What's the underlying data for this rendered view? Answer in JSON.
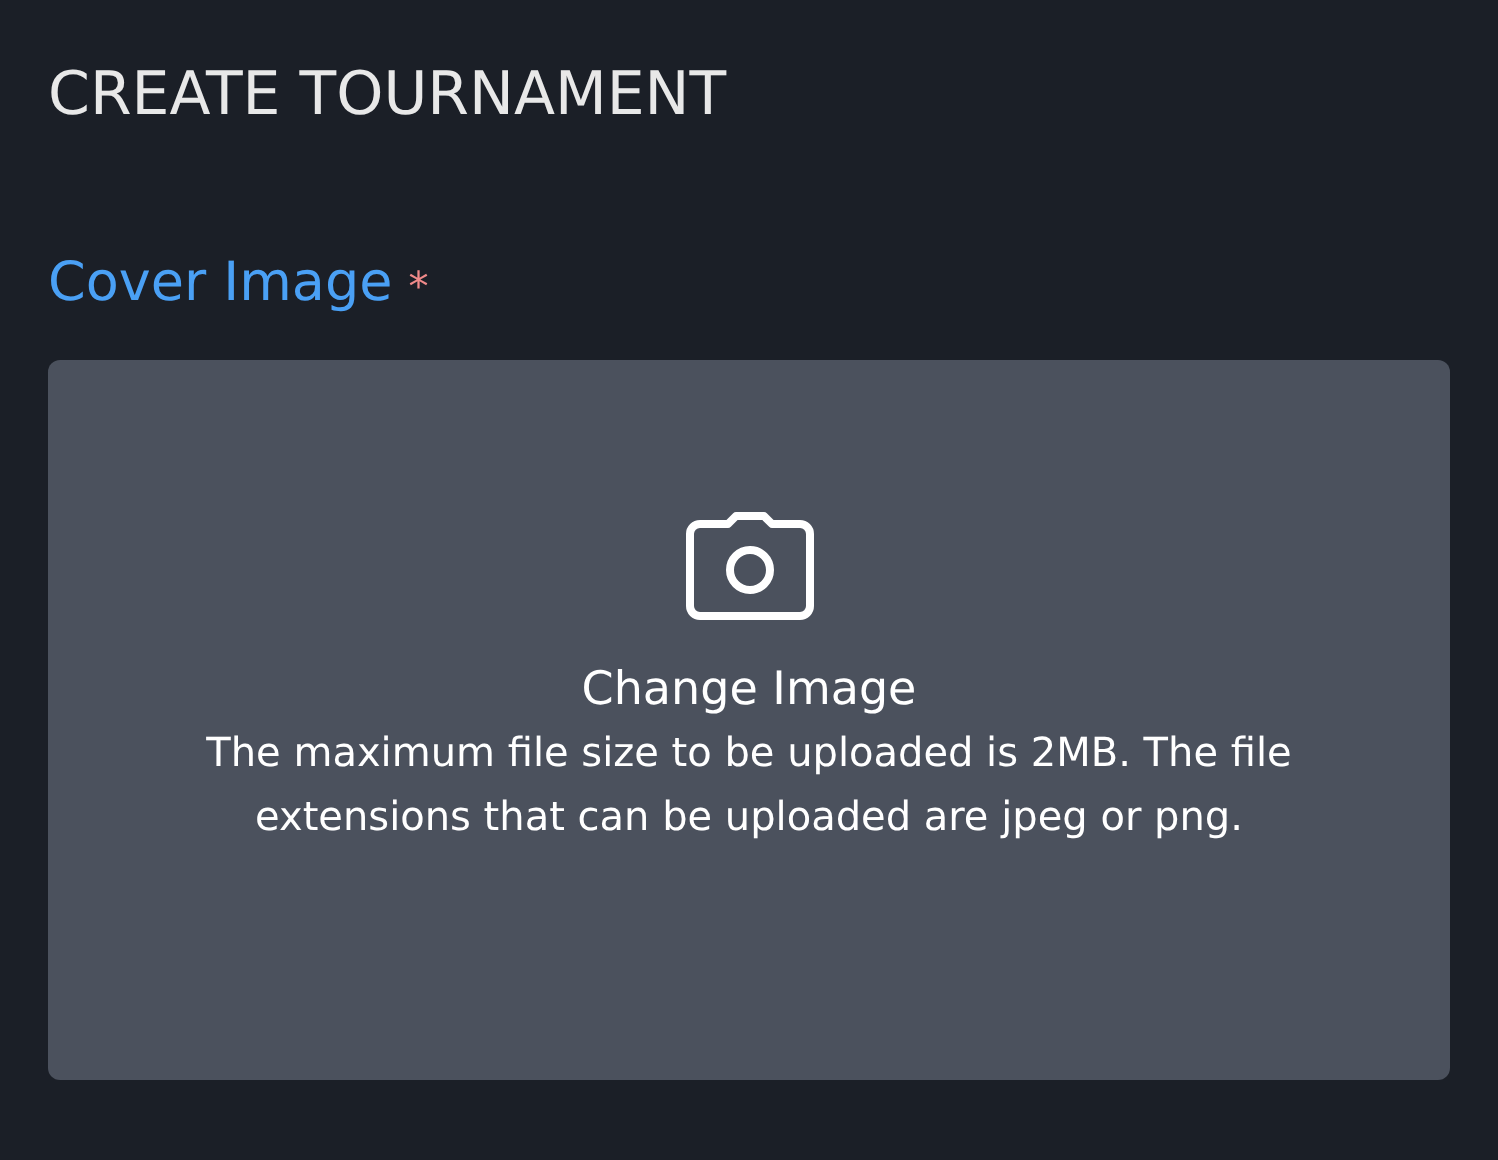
{
  "page": {
    "title": "CREATE TOURNAMENT"
  },
  "cover_image": {
    "label": "Cover Image",
    "required_mark": "*",
    "action": "Change Image",
    "hint": "The maximum file size to be uploaded is 2MB. The file extensions that can be uploaded are jpeg or png."
  }
}
